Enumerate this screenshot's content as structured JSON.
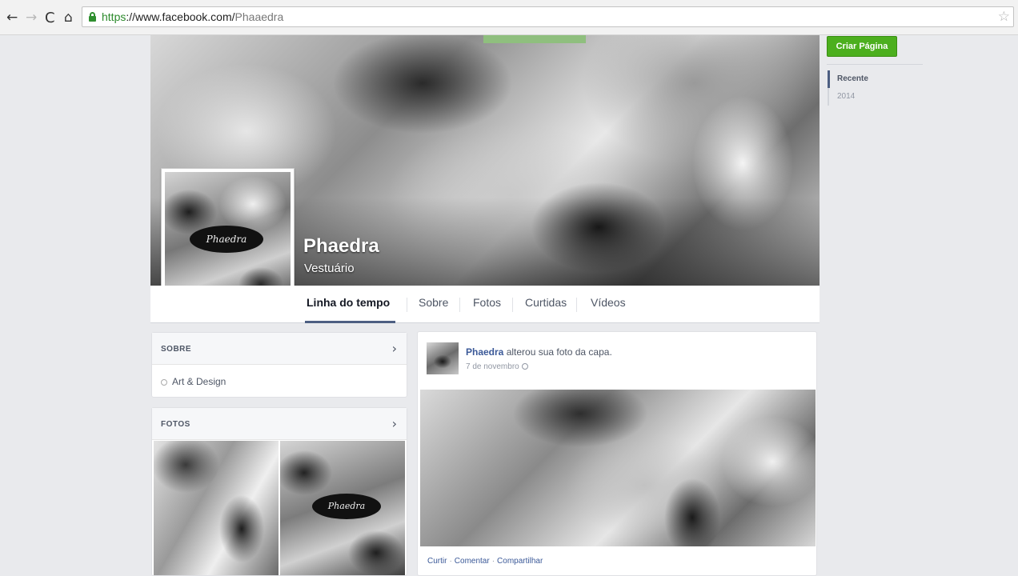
{
  "browser": {
    "nav": {
      "back": "←",
      "forward": "→",
      "reload": "C",
      "home": "⌂"
    },
    "url": {
      "scheme": "https",
      "host": "://www.facebook.com/",
      "path": "Phaaedra"
    },
    "bookmark_icon": "☆"
  },
  "page": {
    "name": "Phaedra",
    "category": "Vestuário",
    "logo_text": "Phaedra"
  },
  "tabs": [
    "Linha do tempo",
    "Sobre",
    "Fotos",
    "Curtidas",
    "Vídeos"
  ],
  "about": {
    "title": "SOBRE",
    "items": [
      "Art & Design"
    ]
  },
  "photos": {
    "title": "FOTOS",
    "logo_text": "Phaedra"
  },
  "chevron": "›",
  "post": {
    "author": "Phaedra",
    "action": " alterou sua foto da capa.",
    "date": "7 de novembro",
    "actions": [
      "Curtir",
      "Comentar",
      "Compartilhar"
    ],
    "separator": "·"
  },
  "sidebar": {
    "create_page": "Criar Página",
    "years": [
      "Recente",
      "2014"
    ]
  },
  "colors": {
    "link": "#3b5998",
    "create_button": "#4caf1e",
    "background": "#e9eaed"
  }
}
